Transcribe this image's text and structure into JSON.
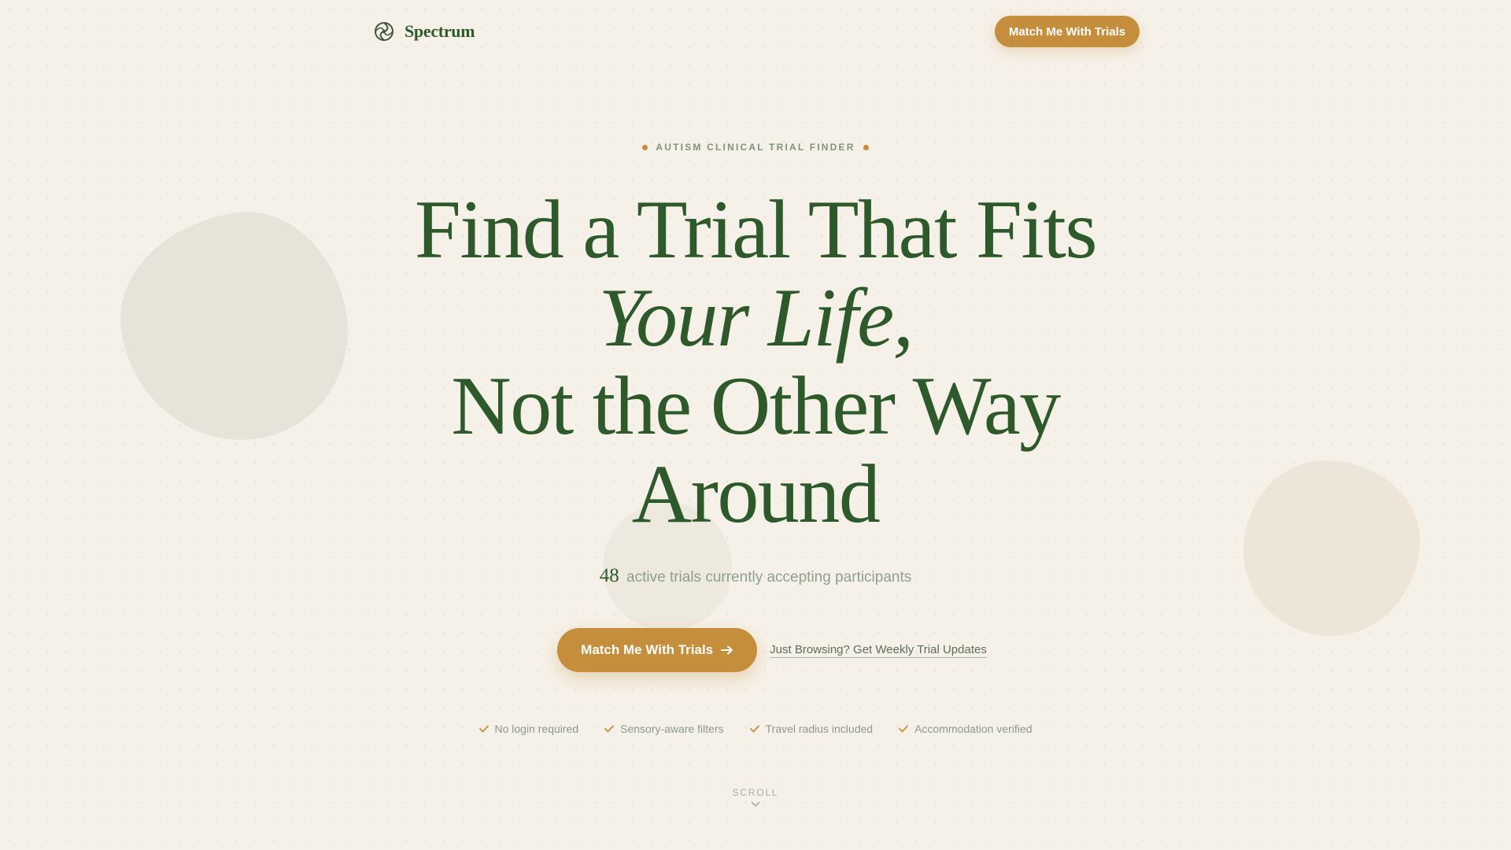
{
  "header": {
    "brand_name": "Spectrum",
    "cta_label": "Match Me With Trials"
  },
  "hero": {
    "eyebrow": "AUTISM CLINICAL TRIAL FINDER",
    "headline_line1": "Find a Trial That Fits",
    "headline_line2": "Your Life,",
    "headline_line3": "Not the Other Way",
    "headline_line4": "Around",
    "stat_number": "48",
    "stat_text": "active trials currently accepting participants",
    "primary_cta": "Match Me With Trials",
    "secondary_link": "Just Browsing? Get Weekly Trial Updates"
  },
  "features": [
    {
      "label": "No login required"
    },
    {
      "label": "Sensory-aware filters"
    },
    {
      "label": "Travel radius included"
    },
    {
      "label": "Accommodation verified"
    }
  ],
  "scroll_label": "SCROLL",
  "icons": {
    "brand": "spectrum-logo-icon",
    "cta_arrow": "arrow-right-icon",
    "feature": "check-icon",
    "scroll": "chevron-down-icon"
  },
  "colors": {
    "background": "#f6f1e8",
    "primary_green": "#2e5a2b",
    "accent_gold": "#c48e3d",
    "muted_text": "#8c9a86"
  }
}
